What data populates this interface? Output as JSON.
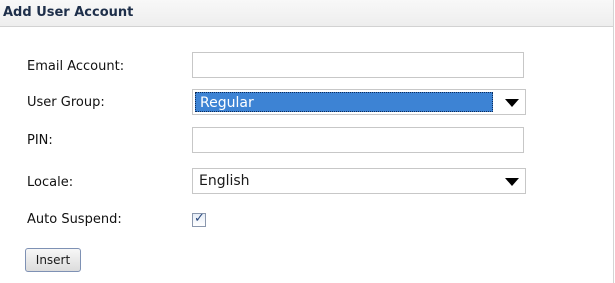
{
  "form": {
    "title": "Add User Account",
    "fields": {
      "email": {
        "label": "Email Account:",
        "value": ""
      },
      "user_group": {
        "label": "User Group:",
        "selected": "Regular"
      },
      "pin": {
        "label": "PIN:",
        "value": ""
      },
      "locale": {
        "label": "Locale:",
        "selected": "English"
      },
      "auto_suspend": {
        "label": "Auto Suspend:",
        "checked": true
      }
    },
    "insert_label": "Insert"
  },
  "colors": {
    "selection_highlight": "#3d83d4",
    "title_text": "#1e2f4a"
  },
  "icons": {
    "dropdown_arrow": "chevron-down-icon",
    "checkbox_mark": "checkmark-icon"
  }
}
